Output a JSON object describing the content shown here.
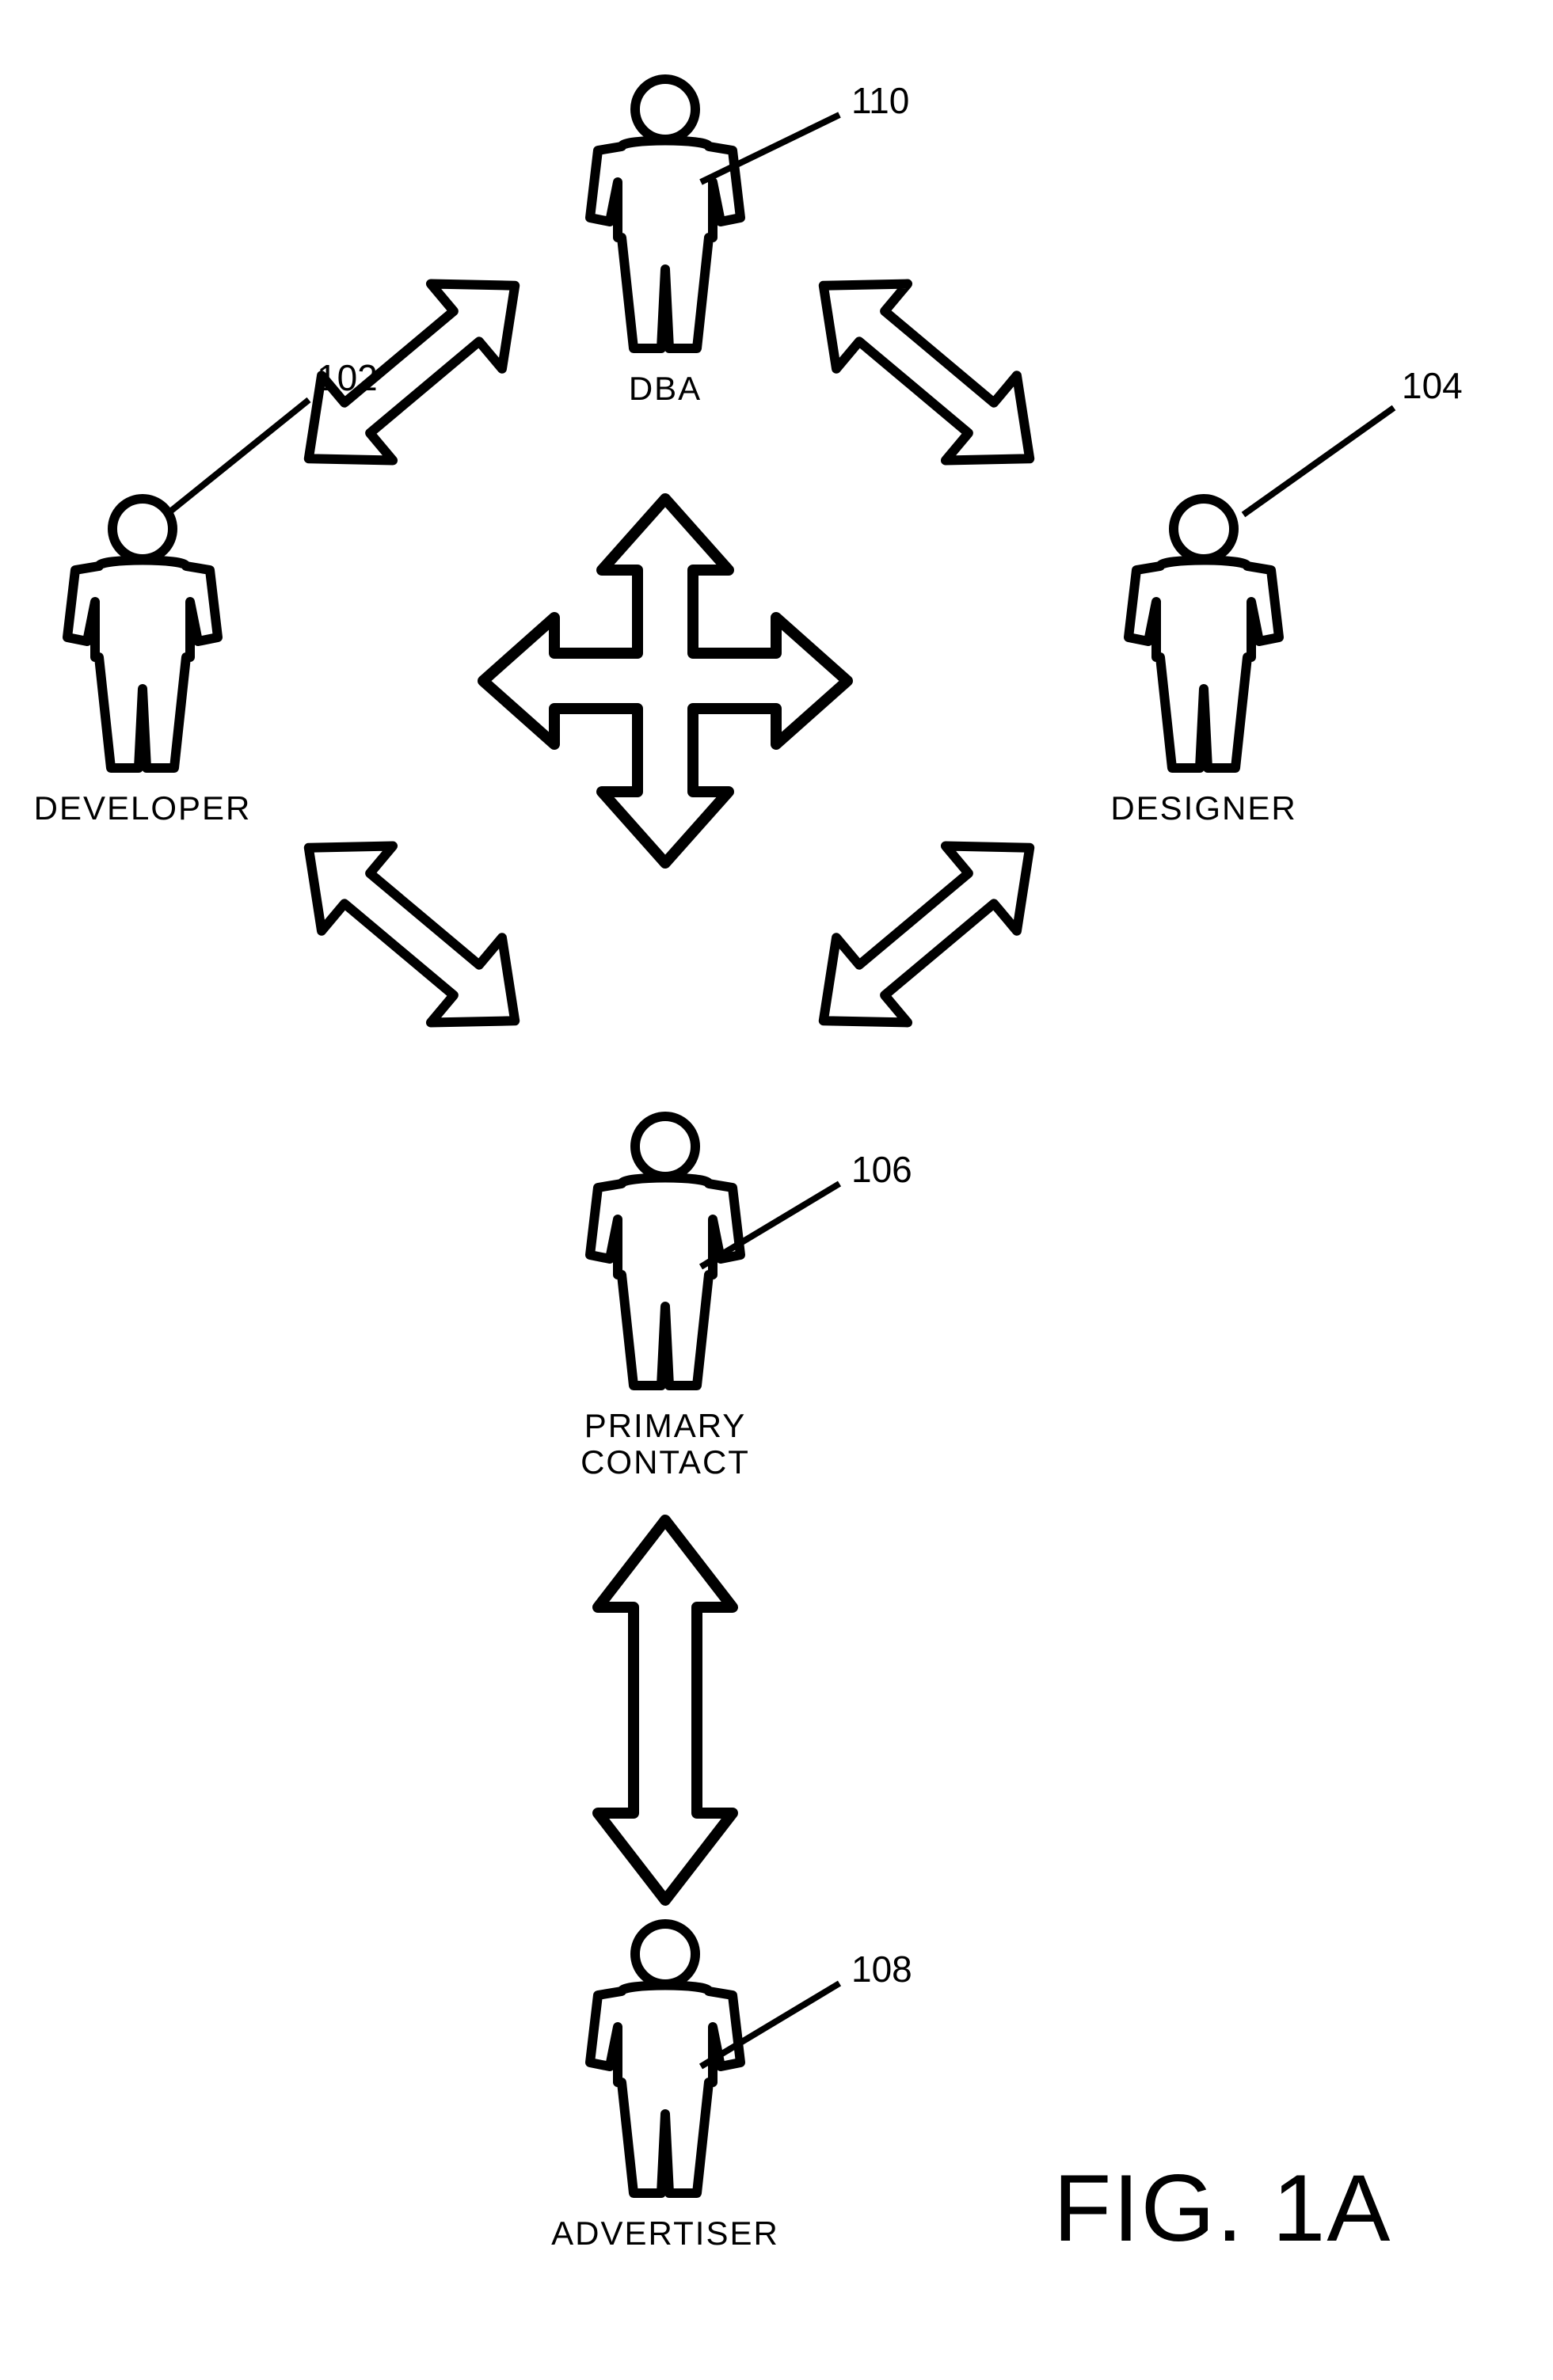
{
  "figure_label": "FIG. 1A",
  "actors": {
    "dba": {
      "label": "DBA",
      "ref": "110"
    },
    "dev": {
      "label": "DEVELOPER",
      "ref": "102"
    },
    "des": {
      "label": "DESIGNER",
      "ref": "104"
    },
    "primary": {
      "label": "PRIMARY\nCONTACT",
      "ref": "106"
    },
    "adv": {
      "label": "ADVERTISER",
      "ref": "108"
    }
  }
}
